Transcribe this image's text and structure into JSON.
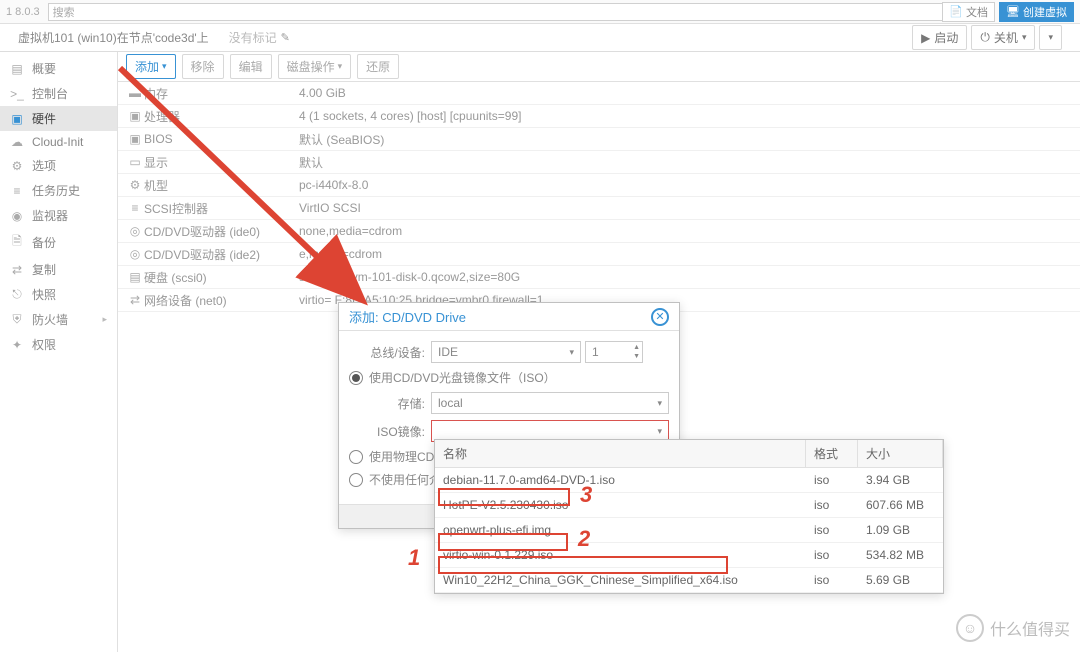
{
  "top": {
    "version": "1 8.0.3",
    "search_placeholder": "搜索",
    "docs": "文档",
    "create": "创建虚拟"
  },
  "header": {
    "breadcrumb": "虚拟机101 (win10)在节点'code3d'上",
    "tag_label": "没有标记",
    "start": "启动",
    "shutdown": "关机"
  },
  "sidebar": [
    {
      "icon": "▤",
      "label": "概要"
    },
    {
      "icon": ">_",
      "label": "控制台"
    },
    {
      "icon": "▣",
      "label": "硬件",
      "active": true
    },
    {
      "icon": "☁",
      "label": "Cloud-Init"
    },
    {
      "icon": "⚙",
      "label": "选项"
    },
    {
      "icon": "≡",
      "label": "任务历史"
    },
    {
      "icon": "◉",
      "label": "监视器"
    },
    {
      "icon": "🗎",
      "label": "备份"
    },
    {
      "icon": "⇄",
      "label": "复制"
    },
    {
      "icon": "⎋",
      "label": "快照"
    },
    {
      "icon": "⛨",
      "label": "防火墙",
      "chev": true
    },
    {
      "icon": "✦",
      "label": "权限"
    }
  ],
  "toolbar": {
    "add": "添加",
    "remove": "移除",
    "edit": "编辑",
    "disk_action": "磁盘操作",
    "revert": "还原"
  },
  "hw": [
    {
      "icon": "▬",
      "label": "内存",
      "val": "4.00 GiB"
    },
    {
      "icon": "▣",
      "label": "处理器",
      "val": "4 (1 sockets, 4 cores) [host] [cpuunits=99]"
    },
    {
      "icon": "▣",
      "label": "BIOS",
      "val": "默认 (SeaBIOS)"
    },
    {
      "icon": "▭",
      "label": "显示",
      "val": "默认"
    },
    {
      "icon": "⚙",
      "label": "机型",
      "val": "pc-i440fx-8.0"
    },
    {
      "icon": "≡",
      "label": "SCSI控制器",
      "val": "VirtIO SCSI"
    },
    {
      "icon": "◎",
      "label": "CD/DVD驱动器 (ide0)",
      "val": "none,media=cdrom"
    },
    {
      "icon": "◎",
      "label": "CD/DVD驱动器 (ide2)",
      "val": "    e,media=cdrom"
    },
    {
      "icon": "▤",
      "label": "硬盘 (scsi0)",
      "val": "sata    :101/vm-101-disk-0.qcow2,size=80G"
    },
    {
      "icon": "⇄",
      "label": "网络设备 (net0)",
      "val": "virtio=         F:8D:A5:10:25,bridge=vmbr0,firewall=1"
    }
  ],
  "dialog": {
    "title": "添加: CD/DVD Drive",
    "bus_label": "总线/设备:",
    "bus_value": "IDE",
    "bus_num": "1",
    "radio_iso": "使用CD/DVD光盘镜像文件（ISO）",
    "storage_label": "存储:",
    "storage_value": "local",
    "iso_label": "ISO镜像:",
    "radio_physical": "使用物理CD/D",
    "radio_none": "不使用任何介质"
  },
  "dropdown": {
    "cols": {
      "name": "名称",
      "fmt": "格式",
      "size": "大小"
    },
    "rows": [
      {
        "name": "debian-11.7.0-amd64-DVD-1.iso",
        "fmt": "iso",
        "size": "3.94 GB"
      },
      {
        "name": "HotPE-V2.5.230430.iso",
        "fmt": "iso",
        "size": "607.66 MB"
      },
      {
        "name": "openwrt-plus-efi.img",
        "fmt": "iso",
        "size": "1.09 GB"
      },
      {
        "name": "virtio-win-0.1.229.iso",
        "fmt": "iso",
        "size": "534.82 MB"
      },
      {
        "name": "Win10_22H2_China_GGK_Chinese_Simplified_x64.iso",
        "fmt": "iso",
        "size": "5.69 GB"
      }
    ]
  },
  "annotations": {
    "n1": "1",
    "n2": "2",
    "n3": "3"
  },
  "watermark": "什么值得买"
}
